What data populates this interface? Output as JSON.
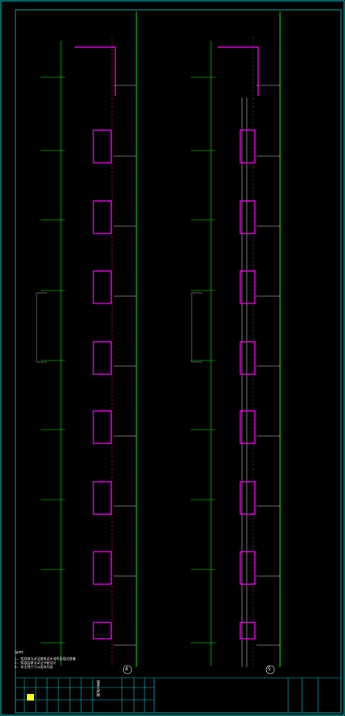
{
  "drawing": {
    "colors": {
      "background": "#000000",
      "frame": "#00c8c8",
      "grid_line": "#00ff00",
      "wall": "#ff00ff",
      "note_text": "#ffffff",
      "dim": "#d0d0d0",
      "highlight": "#ffff00"
    },
    "sections": [
      {
        "marker": "4",
        "bay_count": 9
      },
      {
        "marker": "5",
        "bay_count": 9
      }
    ],
    "notes": {
      "heading": "说明：",
      "lines": [
        "1. 墙身做法详见建筑设计说明及相关图集",
        "2. 保温层做法详见节能设计",
        "3. 未注明尺寸以现场为准"
      ]
    },
    "title_block": {
      "drawing_name": "墙身大样图",
      "icons": [
        "logo-icon"
      ]
    }
  }
}
